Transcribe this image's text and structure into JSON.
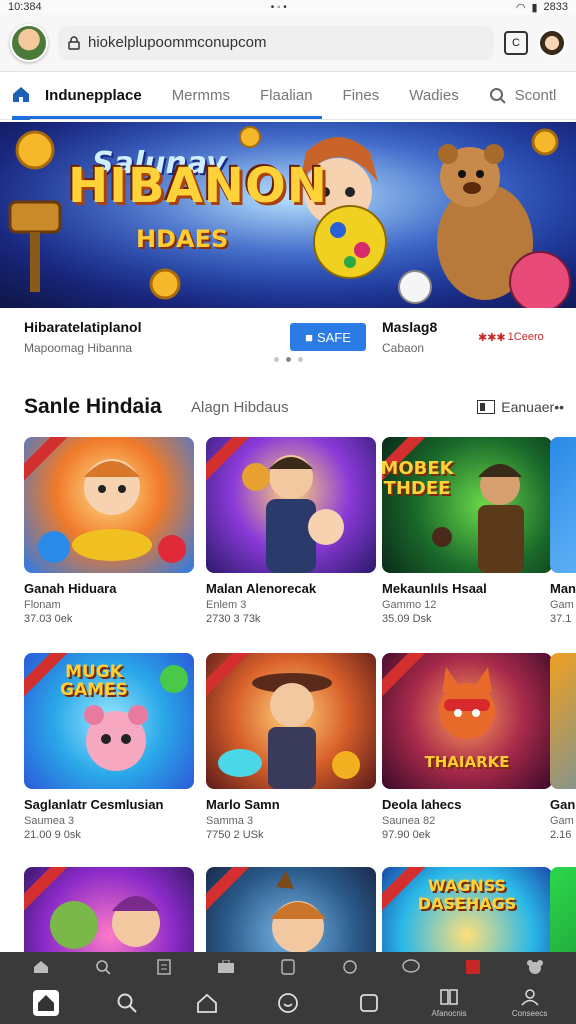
{
  "status": {
    "time": "10:384",
    "right_time": "2833"
  },
  "browser": {
    "url": "hiokelplupoommconupcom",
    "tab_count": "C"
  },
  "nav": {
    "tabs": [
      {
        "label": "Indunepplace"
      },
      {
        "label": "Mermms"
      },
      {
        "label": "Flaalian"
      },
      {
        "label": "Fines"
      },
      {
        "label": "Wadies"
      },
      {
        "label": "Scontl"
      }
    ]
  },
  "hero": {
    "banner_line1": "Salunay",
    "banner_line2": "HIBANON",
    "banner_line3": "HDAES",
    "title": "Hibaratelatiplanol",
    "subtitle": "Mapoomag Hibanna",
    "button": "SAFE",
    "side_title": "Maslag8",
    "side_sub": "Cabaon",
    "rating_text": "1Ceero"
  },
  "section": {
    "title": "Sanle Hindaia",
    "subtitle": "Alagn Hibdaus",
    "more": "Eanuaer••"
  },
  "cards": [
    {
      "name": "Ganah Hiduara",
      "meta": "Flonam",
      "price": "37.03 0ek",
      "label": ""
    },
    {
      "name": "Malan Alenorecak",
      "meta": "Enlem 3",
      "price": "2730 3 73k",
      "label": ""
    },
    {
      "name": "Mekaunlıls Hsaal",
      "meta": "Gammo 12",
      "price": "35.09 Dsk",
      "label": "MOBEK THDEE"
    },
    {
      "name": "Man",
      "meta": "Gam",
      "price": "37.1",
      "label": ""
    },
    {
      "name": "Saglanlatr Cesmlusian",
      "meta": "Saumea 3",
      "price": "21.00 9 0sk",
      "label": "MUGK GAMES"
    },
    {
      "name": "Marlo Samn",
      "meta": "Samma 3",
      "price": "7750 2 USk",
      "label": ""
    },
    {
      "name": "Deola lahecs",
      "meta": "Saunea 82",
      "price": "97.90 0ek",
      "label": "THAIARKE"
    },
    {
      "name": "Gan",
      "meta": "Gam",
      "price": "2.16",
      "label": ""
    },
    {
      "name": "",
      "meta": "",
      "price": "",
      "label": ""
    },
    {
      "name": "",
      "meta": "",
      "price": "",
      "label": ""
    },
    {
      "name": "",
      "meta": "",
      "price": "",
      "label": "WAGNSS DASEHAGS"
    },
    {
      "name": "",
      "meta": "",
      "price": "",
      "label": ""
    }
  ],
  "bottom": {
    "labels": {
      "library": "Afanocnis",
      "account": "Conseecs"
    }
  }
}
